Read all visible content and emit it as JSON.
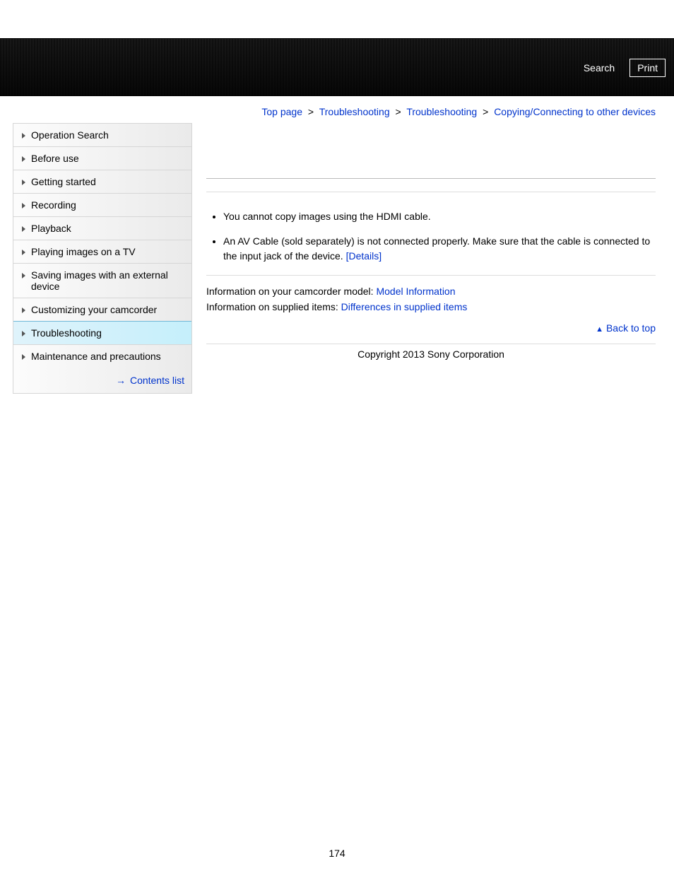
{
  "header": {
    "search_label": "Search",
    "print_label": "Print"
  },
  "breadcrumb": {
    "items": [
      {
        "label": "Top page"
      },
      {
        "label": "Troubleshooting"
      },
      {
        "label": "Troubleshooting"
      },
      {
        "label": "Copying/Connecting to other devices"
      }
    ],
    "separator": ">"
  },
  "sidebar": {
    "items": [
      {
        "label": "Operation Search",
        "active": false
      },
      {
        "label": "Before use",
        "active": false
      },
      {
        "label": "Getting started",
        "active": false
      },
      {
        "label": "Recording",
        "active": false
      },
      {
        "label": "Playback",
        "active": false
      },
      {
        "label": "Playing images on a TV",
        "active": false
      },
      {
        "label": "Saving images with an external device",
        "active": false
      },
      {
        "label": "Customizing your camcorder",
        "active": false
      },
      {
        "label": "Troubleshooting",
        "active": true
      },
      {
        "label": "Maintenance and precautions",
        "active": false
      }
    ],
    "contents_list_label": "Contents list"
  },
  "content": {
    "bullets": [
      {
        "text": "You cannot copy images using the HDMI cable."
      },
      {
        "text": "An AV Cable (sold separately) is not connected properly. Make sure that the cable is connected to the input jack of the device. ",
        "link_label": "[Details]"
      }
    ],
    "model_info_prefix": "Information on your camcorder model: ",
    "model_info_link": "Model Information",
    "supplied_prefix": "Information on supplied items: ",
    "supplied_link": "Differences in supplied items",
    "back_to_top": "Back to top"
  },
  "footer": {
    "copyright": "Copyright 2013 Sony Corporation",
    "page_number": "174"
  }
}
